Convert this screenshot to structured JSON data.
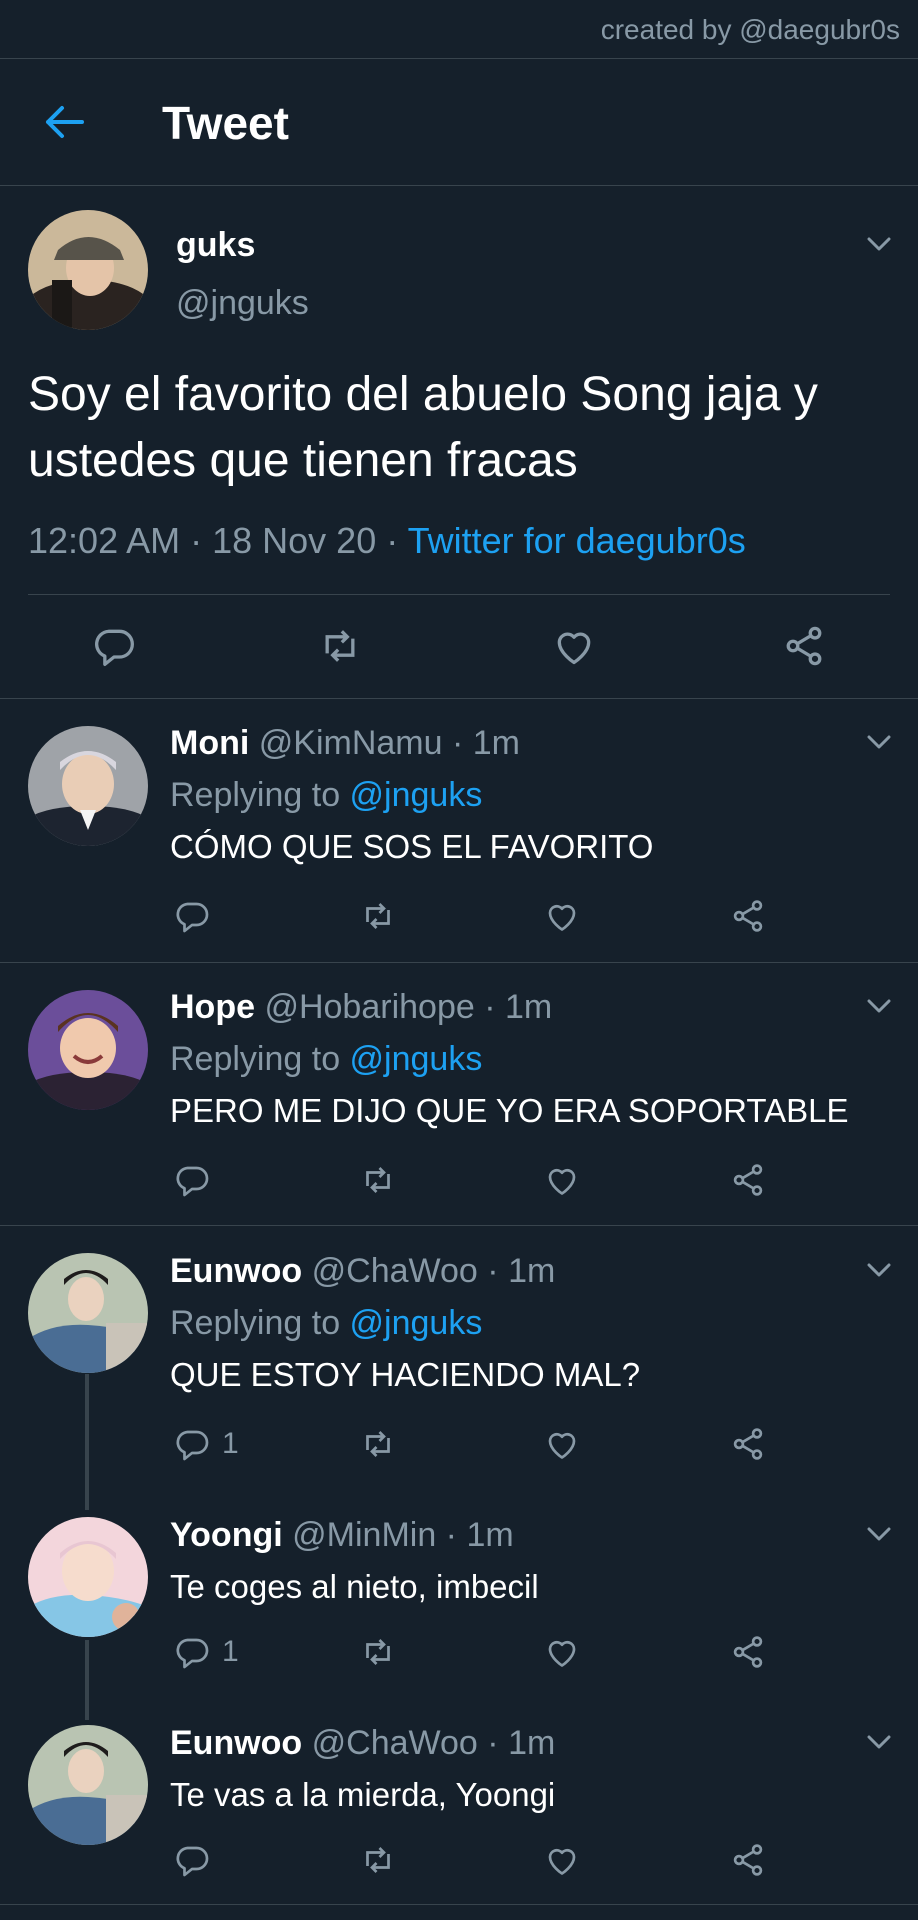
{
  "credit": "created by @daegubr0s",
  "header": {
    "title": "Tweet"
  },
  "main_tweet": {
    "name": "guks",
    "handle": "@jnguks",
    "text": "Soy el favorito del abuelo Song jaja y ustedes que tienen fracas",
    "time": "12:02 AM",
    "sep1": " · ",
    "date": "18 Nov 20",
    "sep2": " · ",
    "source": "Twitter for daegubr0s"
  },
  "replies": [
    {
      "name": "Moni",
      "handle": "@KimNamu",
      "sep": " · ",
      "time": "1m",
      "replying_prefix": "Replying to ",
      "replying_to": "@jnguks",
      "text": "CÓMO QUE SOS EL FAVORITO",
      "reply_count": ""
    },
    {
      "name": "Hope",
      "handle": "@Hobarihope",
      "sep": " · ",
      "time": "1m",
      "replying_prefix": "Replying to ",
      "replying_to": "@jnguks",
      "text": "PERO ME DIJO QUE YO ERA SOPORTABLE",
      "reply_count": ""
    },
    {
      "name": "Eunwoo",
      "handle": "@ChaWoo",
      "sep": " · ",
      "time": "1m",
      "replying_prefix": "Replying to ",
      "replying_to": "@jnguks",
      "text": "QUE ESTOY HACIENDO MAL?",
      "reply_count": "1"
    },
    {
      "name": "Yoongi",
      "handle": "@MinMin",
      "sep": " · ",
      "time": "1m",
      "text": "Te coges al nieto, imbecil",
      "reply_count": "1"
    },
    {
      "name": "Eunwoo",
      "handle": "@ChaWoo",
      "sep": " · ",
      "time": "1m",
      "text": "Te vas a la mierda, Yoongi",
      "reply_count": ""
    }
  ],
  "icons": {
    "back": "arrow-left-icon",
    "reply": "comment-icon",
    "retweet": "retweet-icon",
    "like": "heart-icon",
    "share": "share-icon",
    "more": "chevron-down-icon"
  },
  "colors": {
    "background": "#15202b",
    "accent": "#1da1f2",
    "muted": "#8899a6",
    "divider": "#38444d"
  }
}
